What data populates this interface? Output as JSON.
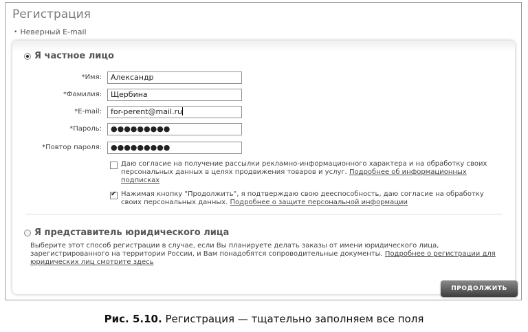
{
  "header": {
    "title": "Регистрация",
    "error_message": "Неверный E-mail"
  },
  "private_section": {
    "radio_label": "Я частное лицо",
    "selected": true,
    "fields": [
      {
        "label": "*Имя:",
        "value": "Александр"
      },
      {
        "label": "*Фамилия:",
        "value": "Щербина"
      },
      {
        "label": "*E-mail:",
        "value": "for-perent@mail.ru"
      },
      {
        "label": "*Пароль:",
        "value": "●●●●●●●●●"
      },
      {
        "label": "*Повтор пароля:",
        "value": "●●●●●●●●●"
      }
    ],
    "consent_ads": {
      "text": "Даю согласие на получение рассылки рекламно-информационного характера и на обработку своих персональных данных в целях продвижения товаров и услуг.",
      "link": "Подробнее об информационных подписках",
      "checked": false
    },
    "consent_capacity": {
      "text": "Нажимая кнопку \"Продолжить\", я подтверждаю свою дееспособность, даю согласие на обработку своих персональных данных.",
      "link": "Подробнее о защите персональной информации",
      "checked": true
    }
  },
  "legal_section": {
    "radio_label": "Я представитель юридического лица",
    "selected": false,
    "description": "Выберите этот способ регистрации в случае, если Вы планируете делать заказы от имени юридического лица, зарегистрированного на территории России, и Вам понадобятся сопроводительные документы.",
    "link": "Подробнее о регистрации для юридических лиц смотрите здесь"
  },
  "continue_label": "ПРОДОЛЖИТЬ",
  "caption": {
    "figure": "Рис. 5.10.",
    "text": "Регистрация — тщательно заполняем все поля"
  }
}
